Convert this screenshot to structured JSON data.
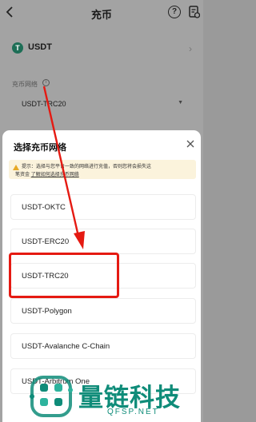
{
  "header": {
    "title": "充币",
    "help_glyph": "?"
  },
  "coin": {
    "symbol_glyph": "T",
    "name": "USDT"
  },
  "network_field": {
    "label": "充币网络",
    "value": "USDT-TRC20"
  },
  "sheet": {
    "title": "选择充币网络",
    "notice": {
      "line1": "提示：选择与您平台一致的网络进行充值，否则您将会损失这",
      "line2_prefix": "笔资金",
      "line2_link": "了解如何选择充币网络"
    },
    "options": [
      {
        "label": "USDT-OKTC"
      },
      {
        "label": "USDT-ERC20"
      },
      {
        "label": "USDT-TRC20",
        "highlighted": true
      },
      {
        "label": "USDT-Polygon"
      },
      {
        "label": "USDT-Avalanche C-Chain"
      },
      {
        "label": "USDT-Arbitrum One"
      }
    ]
  },
  "watermark": {
    "text": "量链科技",
    "url": "QFSP.NET"
  },
  "colors": {
    "highlight": "#e51a12",
    "brand": "#0f8c79",
    "coin": "#1d6e56",
    "warning": "#e7a824"
  }
}
